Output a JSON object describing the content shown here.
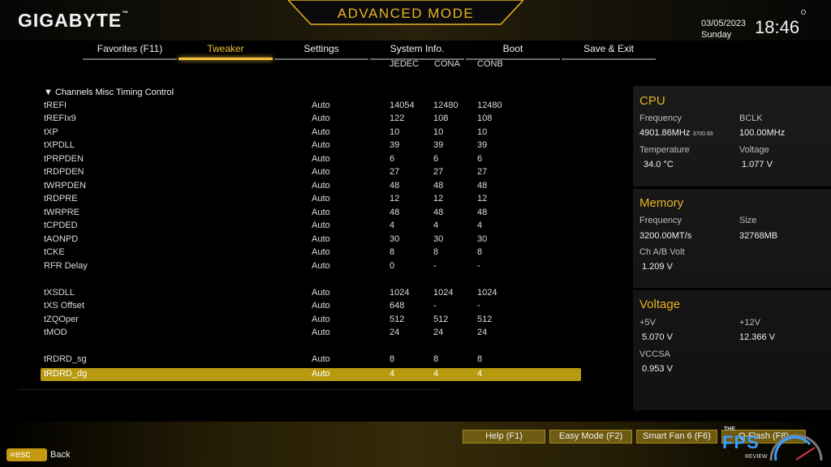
{
  "header": {
    "brand": "GIGABYTE",
    "brand_mark": "™",
    "mode_title": "ADVANCED MODE",
    "date": "03/05/2023",
    "day": "Sunday",
    "time": "18:46"
  },
  "tabs": [
    {
      "label": "Favorites (F11)",
      "active": false
    },
    {
      "label": "Tweaker",
      "active": true
    },
    {
      "label": "Settings",
      "active": false
    },
    {
      "label": "System Info.",
      "active": false
    },
    {
      "label": "Boot",
      "active": false
    },
    {
      "label": "Save & Exit",
      "active": false
    }
  ],
  "columns": {
    "jedec": "JEDEC",
    "cona": "CONA",
    "conb": "CONB"
  },
  "section_title": "Channels Misc Timing Control",
  "rows": [
    {
      "name": "tREFI",
      "mode": "Auto",
      "jedec": "14054",
      "cona": "12480",
      "conb": "12480"
    },
    {
      "name": "tREFIx9",
      "mode": "Auto",
      "jedec": "122",
      "cona": "108",
      "conb": "108"
    },
    {
      "name": "tXP",
      "mode": "Auto",
      "jedec": "10",
      "cona": "10",
      "conb": "10"
    },
    {
      "name": "tXPDLL",
      "mode": "Auto",
      "jedec": "39",
      "cona": "39",
      "conb": "39"
    },
    {
      "name": "tPRPDEN",
      "mode": "Auto",
      "jedec": "6",
      "cona": "6",
      "conb": "6"
    },
    {
      "name": "tRDPDEN",
      "mode": "Auto",
      "jedec": "27",
      "cona": "27",
      "conb": "27"
    },
    {
      "name": "tWRPDEN",
      "mode": "Auto",
      "jedec": "48",
      "cona": "48",
      "conb": "48"
    },
    {
      "name": "tRDPRE",
      "mode": "Auto",
      "jedec": "12",
      "cona": "12",
      "conb": "12"
    },
    {
      "name": "tWRPRE",
      "mode": "Auto",
      "jedec": "48",
      "cona": "48",
      "conb": "48"
    },
    {
      "name": "tCPDED",
      "mode": "Auto",
      "jedec": "4",
      "cona": "4",
      "conb": "4"
    },
    {
      "name": "tAONPD",
      "mode": "Auto",
      "jedec": "30",
      "cona": "30",
      "conb": "30"
    },
    {
      "name": "tCKE",
      "mode": "Auto",
      "jedec": "8",
      "cona": "8",
      "conb": "8"
    },
    {
      "name": "RFR Delay",
      "mode": "Auto",
      "jedec": "0",
      "cona": "-",
      "conb": "-"
    },
    {
      "name": "tXSDLL",
      "mode": "Auto",
      "jedec": "1024",
      "cona": "1024",
      "conb": "1024"
    },
    {
      "name": "tXS Offset",
      "mode": "Auto",
      "jedec": "648",
      "cona": "-",
      "conb": "-"
    },
    {
      "name": "tZQOper",
      "mode": "Auto",
      "jedec": "512",
      "cona": "512",
      "conb": "512"
    },
    {
      "name": "tMOD",
      "mode": "Auto",
      "jedec": "24",
      "cona": "24",
      "conb": "24"
    },
    {
      "name": "tRDRD_sg",
      "mode": "Auto",
      "jedec": "8",
      "cona": "8",
      "conb": "8"
    },
    {
      "name": "tRDRD_dg",
      "mode": "Auto",
      "jedec": "4",
      "cona": "4",
      "conb": "4",
      "selected": true
    }
  ],
  "cpu": {
    "title": "CPU",
    "frequency_label": "Frequency",
    "frequency_value": "4901.86MHz",
    "frequency_sub": "3700.66",
    "bclk_label": "BCLK",
    "bclk_value": "100.00MHz",
    "temperature_label": "Temperature",
    "temperature_value": "34.0 °C",
    "voltage_label": "Voltage",
    "voltage_value": "1.077 V"
  },
  "memory": {
    "title": "Memory",
    "frequency_label": "Frequency",
    "frequency_value": "3200.00MT/s",
    "size_label": "Size",
    "size_value": "32768MB",
    "chab_label": "Ch A/B Volt",
    "chab_value": "1.209 V"
  },
  "voltage": {
    "title": "Voltage",
    "v5_label": "+5V",
    "v5_value": "5.070 V",
    "v12_label": "+12V",
    "v12_value": "12.366 V",
    "vccsa_label": "VCCSA",
    "vccsa_value": "0.953 V"
  },
  "footer": {
    "help": "Help (F1)",
    "easy_mode": "Easy Mode (F2)",
    "smart_fan": "Smart Fan 6 (F6)",
    "qflash": "Q-Flash (F8)",
    "esc": "esc",
    "back": "Back"
  },
  "watermark": {
    "the": "THE",
    "fps": "FPS",
    "review": "REVIEW"
  },
  "colors": {
    "accent": "#e8b320",
    "selected_row": "#b89a10",
    "watermark_blue": "#3aa0ff"
  }
}
